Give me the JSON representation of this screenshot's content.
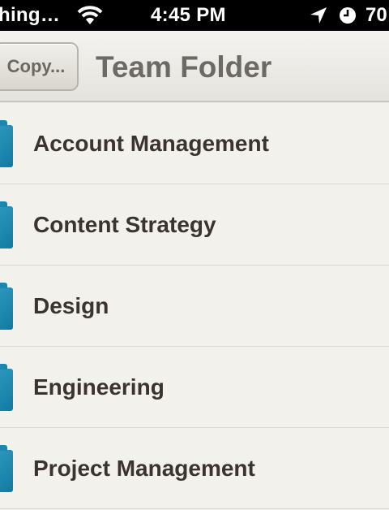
{
  "status_bar": {
    "carrier": "hing…",
    "time": "4:45 PM",
    "battery": "70",
    "icons": [
      "wifi-icon",
      "location-arrow-icon",
      "clock-icon"
    ]
  },
  "nav": {
    "back_label": "Copy...",
    "title": "Team Folder"
  },
  "folders": [
    {
      "label": "Account Management",
      "icon": "folder-icon"
    },
    {
      "label": "Content Strategy",
      "icon": "folder-icon"
    },
    {
      "label": "Design",
      "icon": "folder-icon"
    },
    {
      "label": "Engineering",
      "icon": "folder-icon"
    },
    {
      "label": "Project Management",
      "icon": "folder-icon"
    }
  ],
  "colors": {
    "folder": "#1a88b0",
    "text": "#3a3330",
    "title": "#6d6a65",
    "background": "#f2f0eb"
  }
}
